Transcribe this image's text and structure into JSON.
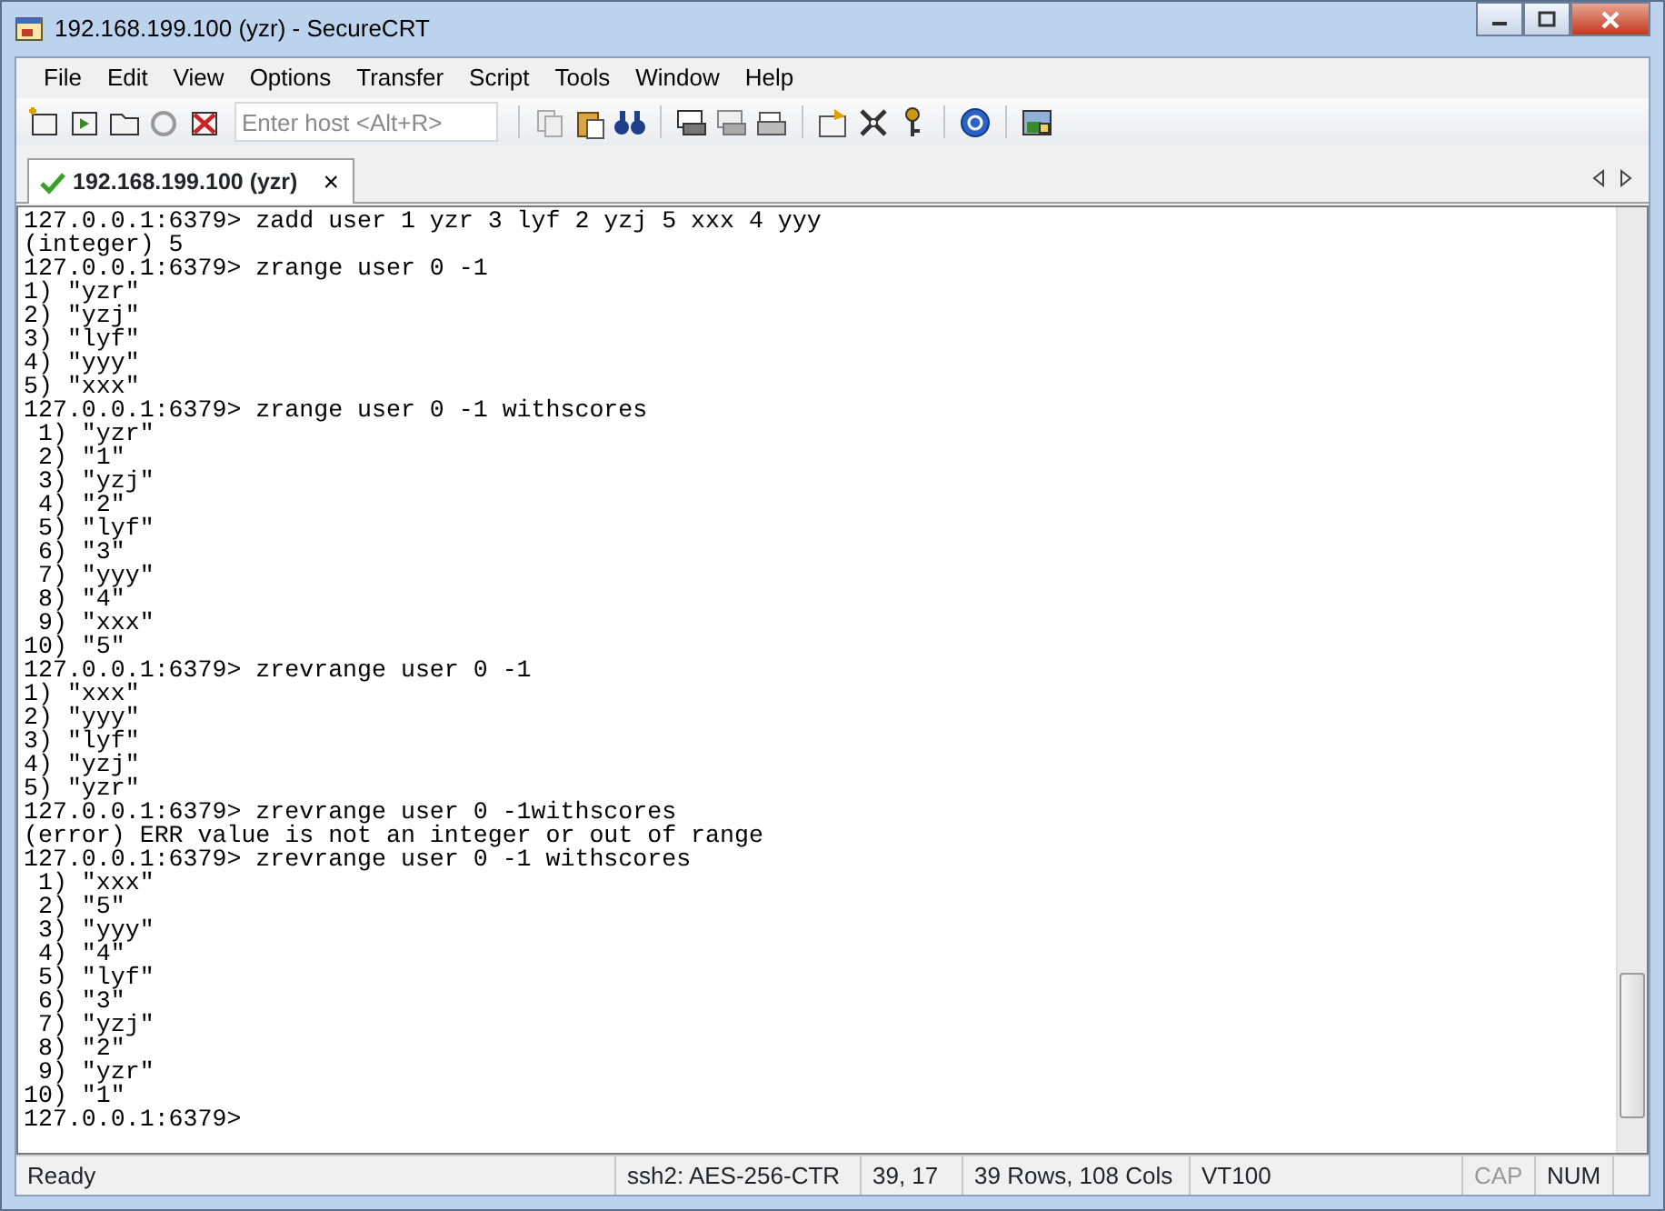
{
  "window": {
    "title": "192.168.199.100 (yzr) - SecureCRT"
  },
  "menu": [
    "File",
    "Edit",
    "View",
    "Options",
    "Transfer",
    "Script",
    "Tools",
    "Window",
    "Help"
  ],
  "toolbar": {
    "host_field": {
      "placeholder": "Enter host <Alt+R>"
    }
  },
  "tabs": [
    {
      "label": "192.168.199.100 (yzr)",
      "selected": true,
      "connected": true,
      "close": "×"
    }
  ],
  "terminal": {
    "lines": [
      "127.0.0.1:6379> zadd user 1 yzr 3 lyf 2 yzj 5 xxx 4 yyy",
      "(integer) 5",
      "127.0.0.1:6379> zrange user 0 -1",
      "1) \"yzr\"",
      "2) \"yzj\"",
      "3) \"lyf\"",
      "4) \"yyy\"",
      "5) \"xxx\"",
      "127.0.0.1:6379> zrange user 0 -1 withscores",
      " 1) \"yzr\"",
      " 2) \"1\"",
      " 3) \"yzj\"",
      " 4) \"2\"",
      " 5) \"lyf\"",
      " 6) \"3\"",
      " 7) \"yyy\"",
      " 8) \"4\"",
      " 9) \"xxx\"",
      "10) \"5\"",
      "127.0.0.1:6379> zrevrange user 0 -1",
      "1) \"xxx\"",
      "2) \"yyy\"",
      "3) \"lyf\"",
      "4) \"yzj\"",
      "5) \"yzr\"",
      "127.0.0.1:6379> zrevrange user 0 -1withscores",
      "(error) ERR value is not an integer or out of range",
      "127.0.0.1:6379> zrevrange user 0 -1 withscores",
      " 1) \"xxx\"",
      " 2) \"5\"",
      " 3) \"yyy\"",
      " 4) \"4\"",
      " 5) \"lyf\"",
      " 6) \"3\"",
      " 7) \"yzj\"",
      " 8) \"2\"",
      " 9) \"yzr\"",
      "10) \"1\"",
      "127.0.0.1:6379>"
    ]
  },
  "status_bar": [
    {
      "text": "Ready",
      "disabled": false
    },
    {
      "text": "ssh2: AES-256-CTR",
      "disabled": false
    },
    {
      "text": "39,  17",
      "disabled": false
    },
    {
      "text": "39 Rows, 108 Cols",
      "disabled": false
    },
    {
      "text": "VT100",
      "disabled": false
    },
    {
      "text": "CAP",
      "disabled": true
    },
    {
      "text": "NUM",
      "disabled": false
    }
  ]
}
